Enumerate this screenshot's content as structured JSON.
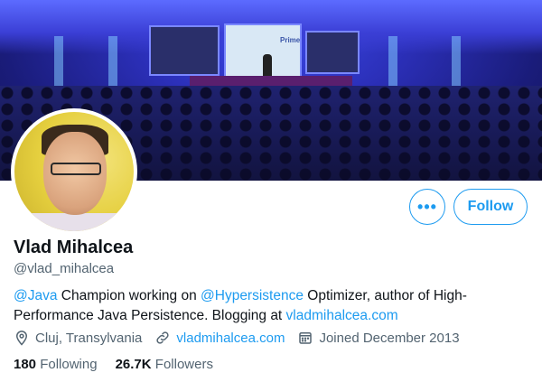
{
  "profile": {
    "name": "Vlad Mihalcea",
    "handle": "@vlad_mihalcea",
    "bio": {
      "mention_1": "@Java",
      "text_1": " Champion working on ",
      "mention_2": "@Hypersistence",
      "text_2": " Optimizer, author of High-Performance Java Persistence. Blogging at ",
      "link": "vladmihalcea.com"
    },
    "location": "Cluj, Transylvania",
    "website": "vladmihalcea.com",
    "joined": "Joined December 2013",
    "following_count": "180",
    "following_label": "Following",
    "followers_count": "26.7K",
    "followers_label": "Followers"
  },
  "banner": {
    "screen_text": "Prime"
  },
  "actions": {
    "more_label": "•••",
    "follow_label": "Follow"
  },
  "icons": {
    "location": "location-pin-icon",
    "website": "link-icon",
    "joined": "calendar-icon",
    "more": "more-dots-icon"
  },
  "colors": {
    "accent": "#1d9bf0",
    "text_primary": "#0f1419",
    "text_secondary": "#536471"
  }
}
